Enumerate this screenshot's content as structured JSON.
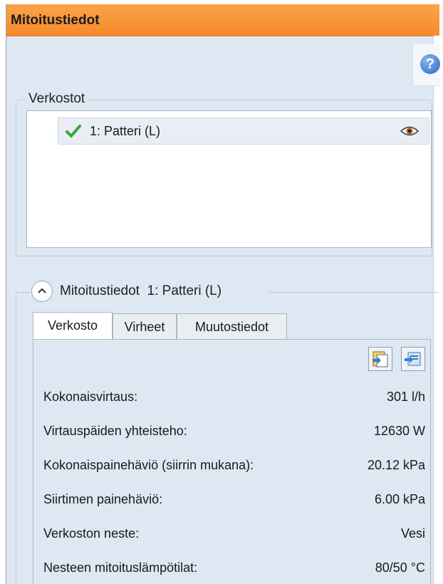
{
  "window": {
    "title": "Mitoitustiedot",
    "help_label": "?"
  },
  "verkostot": {
    "legend": "Verkostot",
    "items": [
      {
        "label": "1: Patteri (L)",
        "status_icon": "check-icon",
        "view_icon": "eye-icon"
      }
    ]
  },
  "section": {
    "title": "Mitoitustiedot",
    "network": "1: Patteri (L)"
  },
  "tabs": [
    {
      "label": "Verkosto",
      "active": true
    },
    {
      "label": "Virheet",
      "active": false
    },
    {
      "label": "Muutostiedot",
      "active": false
    }
  ],
  "toolbar": {
    "icons": [
      "report-icon",
      "export-icon"
    ]
  },
  "rows": [
    {
      "label": "Kokonaisvirtaus:",
      "value": "301 l/h"
    },
    {
      "label": "Virtauspäiden yhteisteho:",
      "value": "12630 W"
    },
    {
      "label": "Kokonaispainehäviö (siirrin mukana):",
      "value": "20.12 kPa"
    },
    {
      "label": "Siirtimen painehäviö:",
      "value": "6.00 kPa"
    },
    {
      "label": "Verkoston neste:",
      "value": "Vesi"
    },
    {
      "label": "Nesteen mitoituslämpötilat:",
      "value": "80/50 °C"
    }
  ],
  "colors": {
    "title_bar": "#f7952f",
    "panel_bg": "#dde8f2",
    "check": "#3aa63a",
    "help": "#2d69c6"
  }
}
